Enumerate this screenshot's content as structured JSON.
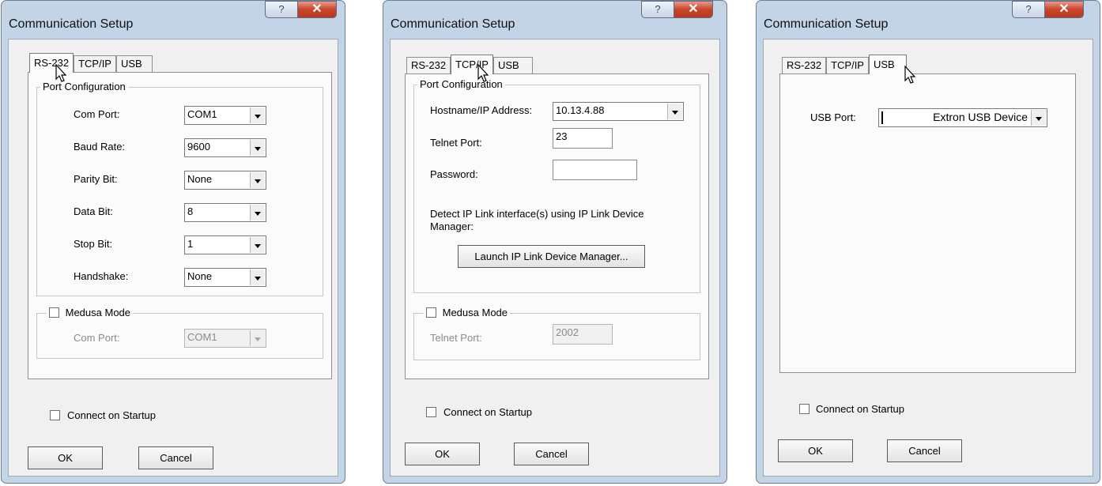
{
  "win1": {
    "title": "Communication Setup",
    "help_icon": "help-icon",
    "close_icon": "close-icon",
    "tabs": [
      "RS-232",
      "TCP/IP",
      "USB"
    ],
    "port_config_legend": "Port Configuration",
    "fields": [
      {
        "label": "Com Port:",
        "value": "COM1"
      },
      {
        "label": "Baud Rate:",
        "value": "9600"
      },
      {
        "label": "Parity Bit:",
        "value": "None"
      },
      {
        "label": "Data Bit:",
        "value": "8"
      },
      {
        "label": "Stop Bit:",
        "value": "1"
      },
      {
        "label": "Handshake:",
        "value": "None"
      }
    ],
    "medusa_legend": "Medusa Mode",
    "medusa_comport_label": "Com Port:",
    "medusa_comport_value": "COM1",
    "connect_label": "Connect on Startup",
    "ok": "OK",
    "cancel": "Cancel"
  },
  "win2": {
    "title": "Communication Setup",
    "tabs": [
      "RS-232",
      "TCP/IP",
      "USB"
    ],
    "port_config_legend": "Port Configuration",
    "host_label": "Hostname/IP Address:",
    "host_value": "10.13.4.88",
    "telnet_label": "Telnet Port:",
    "telnet_value": "23",
    "password_label": "Password:",
    "password_value": "",
    "detect_text_1": "Detect IP Link interface(s) using IP Link Device",
    "detect_text_2": "Manager:",
    "launch_button": "Launch IP Link Device Manager...",
    "medusa_legend": "Medusa Mode",
    "medusa_telnet_label": "Telnet Port:",
    "medusa_telnet_value": "2002",
    "connect_label": "Connect on Startup",
    "ok": "OK",
    "cancel": "Cancel"
  },
  "win3": {
    "title": "Communication Setup",
    "tabs": [
      "RS-232",
      "TCP/IP",
      "USB"
    ],
    "usb_port_label": "USB Port:",
    "usb_port_value": "Extron USB Device",
    "connect_label": "Connect on Startup",
    "ok": "OK",
    "cancel": "Cancel"
  }
}
